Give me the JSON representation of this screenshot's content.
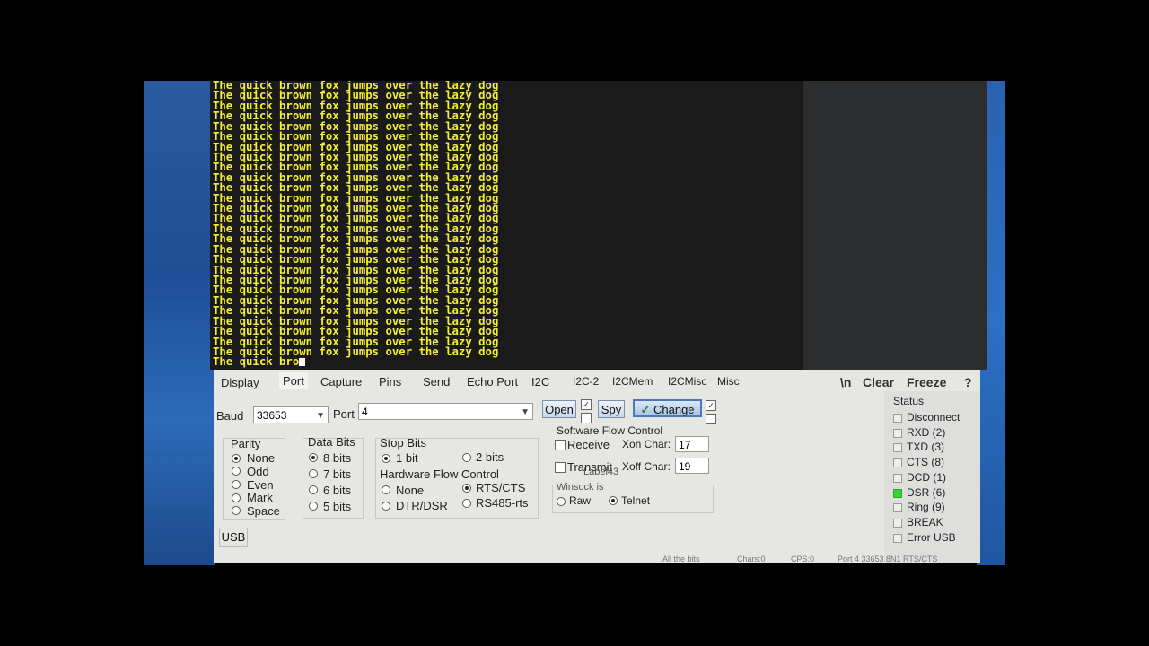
{
  "terminal": {
    "line": "The quick brown fox jumps over the lazy dog",
    "repeat_count": 27,
    "partial_line": "The quick bro"
  },
  "tabs": [
    "Display",
    "Port",
    "Capture",
    "Pins",
    "Send",
    "Echo Port",
    "I2C",
    "I2C-2",
    "I2CMem",
    "I2CMisc",
    "Misc"
  ],
  "active_tab": "Port",
  "top_right": {
    "newline": "\\n",
    "clear": "Clear",
    "freeze": "Freeze",
    "help": "?"
  },
  "baud": {
    "label": "Baud",
    "value": "33653"
  },
  "port": {
    "label": "Port",
    "value": "4"
  },
  "buttons": {
    "open": "Open",
    "spy": "Spy",
    "change": "Change",
    "change_check": "✓",
    "usb": "USB"
  },
  "parity": {
    "title": "Parity",
    "options": [
      "None",
      "Odd",
      "Even",
      "Mark",
      "Space"
    ],
    "selected": "None"
  },
  "data_bits": {
    "title": "Data Bits",
    "options": [
      "8 bits",
      "7 bits",
      "6 bits",
      "5 bits"
    ],
    "selected": "8 bits"
  },
  "stop_bits": {
    "title": "Stop Bits",
    "options": [
      "1 bit",
      "2 bits"
    ],
    "selected": "1 bit"
  },
  "hw_flow": {
    "title": "Hardware Flow Control",
    "options": [
      "None",
      "RTS/CTS",
      "DTR/DSR",
      "RS485-rts"
    ],
    "selected": "RTS/CTS"
  },
  "sw_flow": {
    "title": "Software Flow Control",
    "receive": "Receive",
    "transmit": "Transmit",
    "xon_label": "Xon Char:",
    "xon_value": "17",
    "xoff_label": "Xoff Char:",
    "xoff_value": "19",
    "overlap_label": "Label43"
  },
  "winsock": {
    "title": "Winsock is",
    "options": [
      "Raw",
      "Telnet"
    ],
    "selected": "Telnet"
  },
  "status": {
    "title": "Status",
    "items": [
      {
        "label": "Disconnect",
        "on": false
      },
      {
        "label": "RXD (2)",
        "on": false
      },
      {
        "label": "TXD (3)",
        "on": false
      },
      {
        "label": "CTS (8)",
        "on": false
      },
      {
        "label": "DCD (1)",
        "on": false
      },
      {
        "label": "DSR (6)",
        "on": true
      },
      {
        "label": "Ring (9)",
        "on": false
      },
      {
        "label": "BREAK",
        "on": false
      },
      {
        "label": "Error USB",
        "on": false
      }
    ],
    "led_on_color": "#33d633"
  },
  "statusbar": {
    "left": "All the bits",
    "chars": "Chars:0",
    "cps": "CPS:0",
    "port_info": "Port 4 33653 8N1 RTS/CTS"
  },
  "colors": {
    "terminal_text": "#f2ee3a",
    "terminal_bg": "#1a1a1a",
    "panel_bg": "#e6e6e3"
  }
}
